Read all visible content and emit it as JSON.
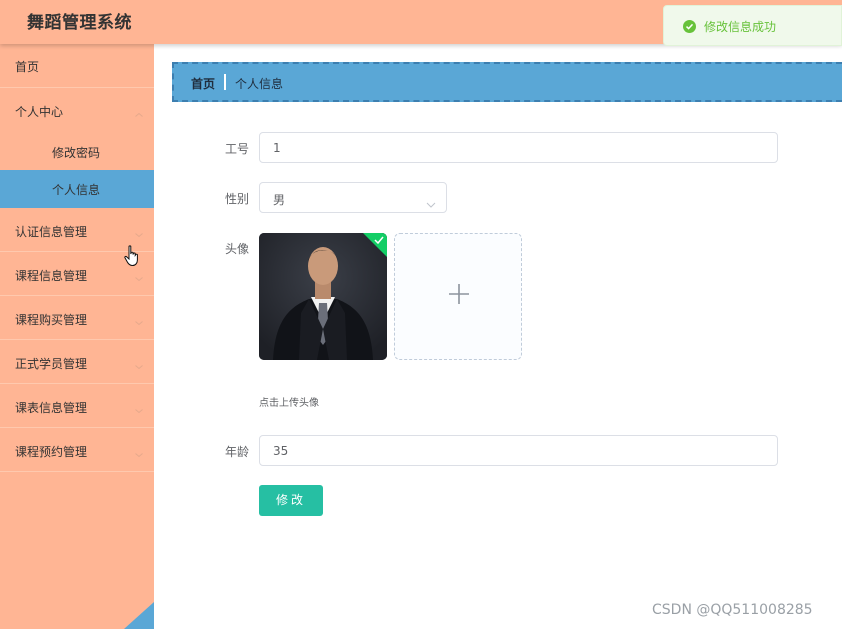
{
  "app": {
    "title": "舞蹈管理系统"
  },
  "toast": {
    "message": "修改信息成功",
    "icon": "success-check-icon",
    "color": "#67c23a"
  },
  "colors": {
    "topbar": "#ffb594",
    "sidebar": "#ffb594",
    "active": "#5aa7d6",
    "primary_button": "#26bfa3"
  },
  "sidebar": {
    "items": [
      {
        "label": "首页"
      },
      {
        "label": "个人中心",
        "expanded": true,
        "children": [
          {
            "label": "修改密码"
          },
          {
            "label": "个人信息",
            "active": true
          }
        ]
      },
      {
        "label": "认证信息管理"
      },
      {
        "label": "课程信息管理"
      },
      {
        "label": "课程购买管理"
      },
      {
        "label": "正式学员管理"
      },
      {
        "label": "课表信息管理"
      },
      {
        "label": "课程预约管理"
      }
    ]
  },
  "breadcrumb": {
    "home": "首页",
    "separator": "|",
    "current": "个人信息"
  },
  "form": {
    "id_label": "工号",
    "id_value": "1",
    "gender_label": "性别",
    "gender_value": "男",
    "avatar_label": "头像",
    "upload_tip": "点击上传头像",
    "age_label": "年龄",
    "age_value": "35",
    "submit_label": "修改"
  },
  "watermark": "CSDN @QQ511008285"
}
